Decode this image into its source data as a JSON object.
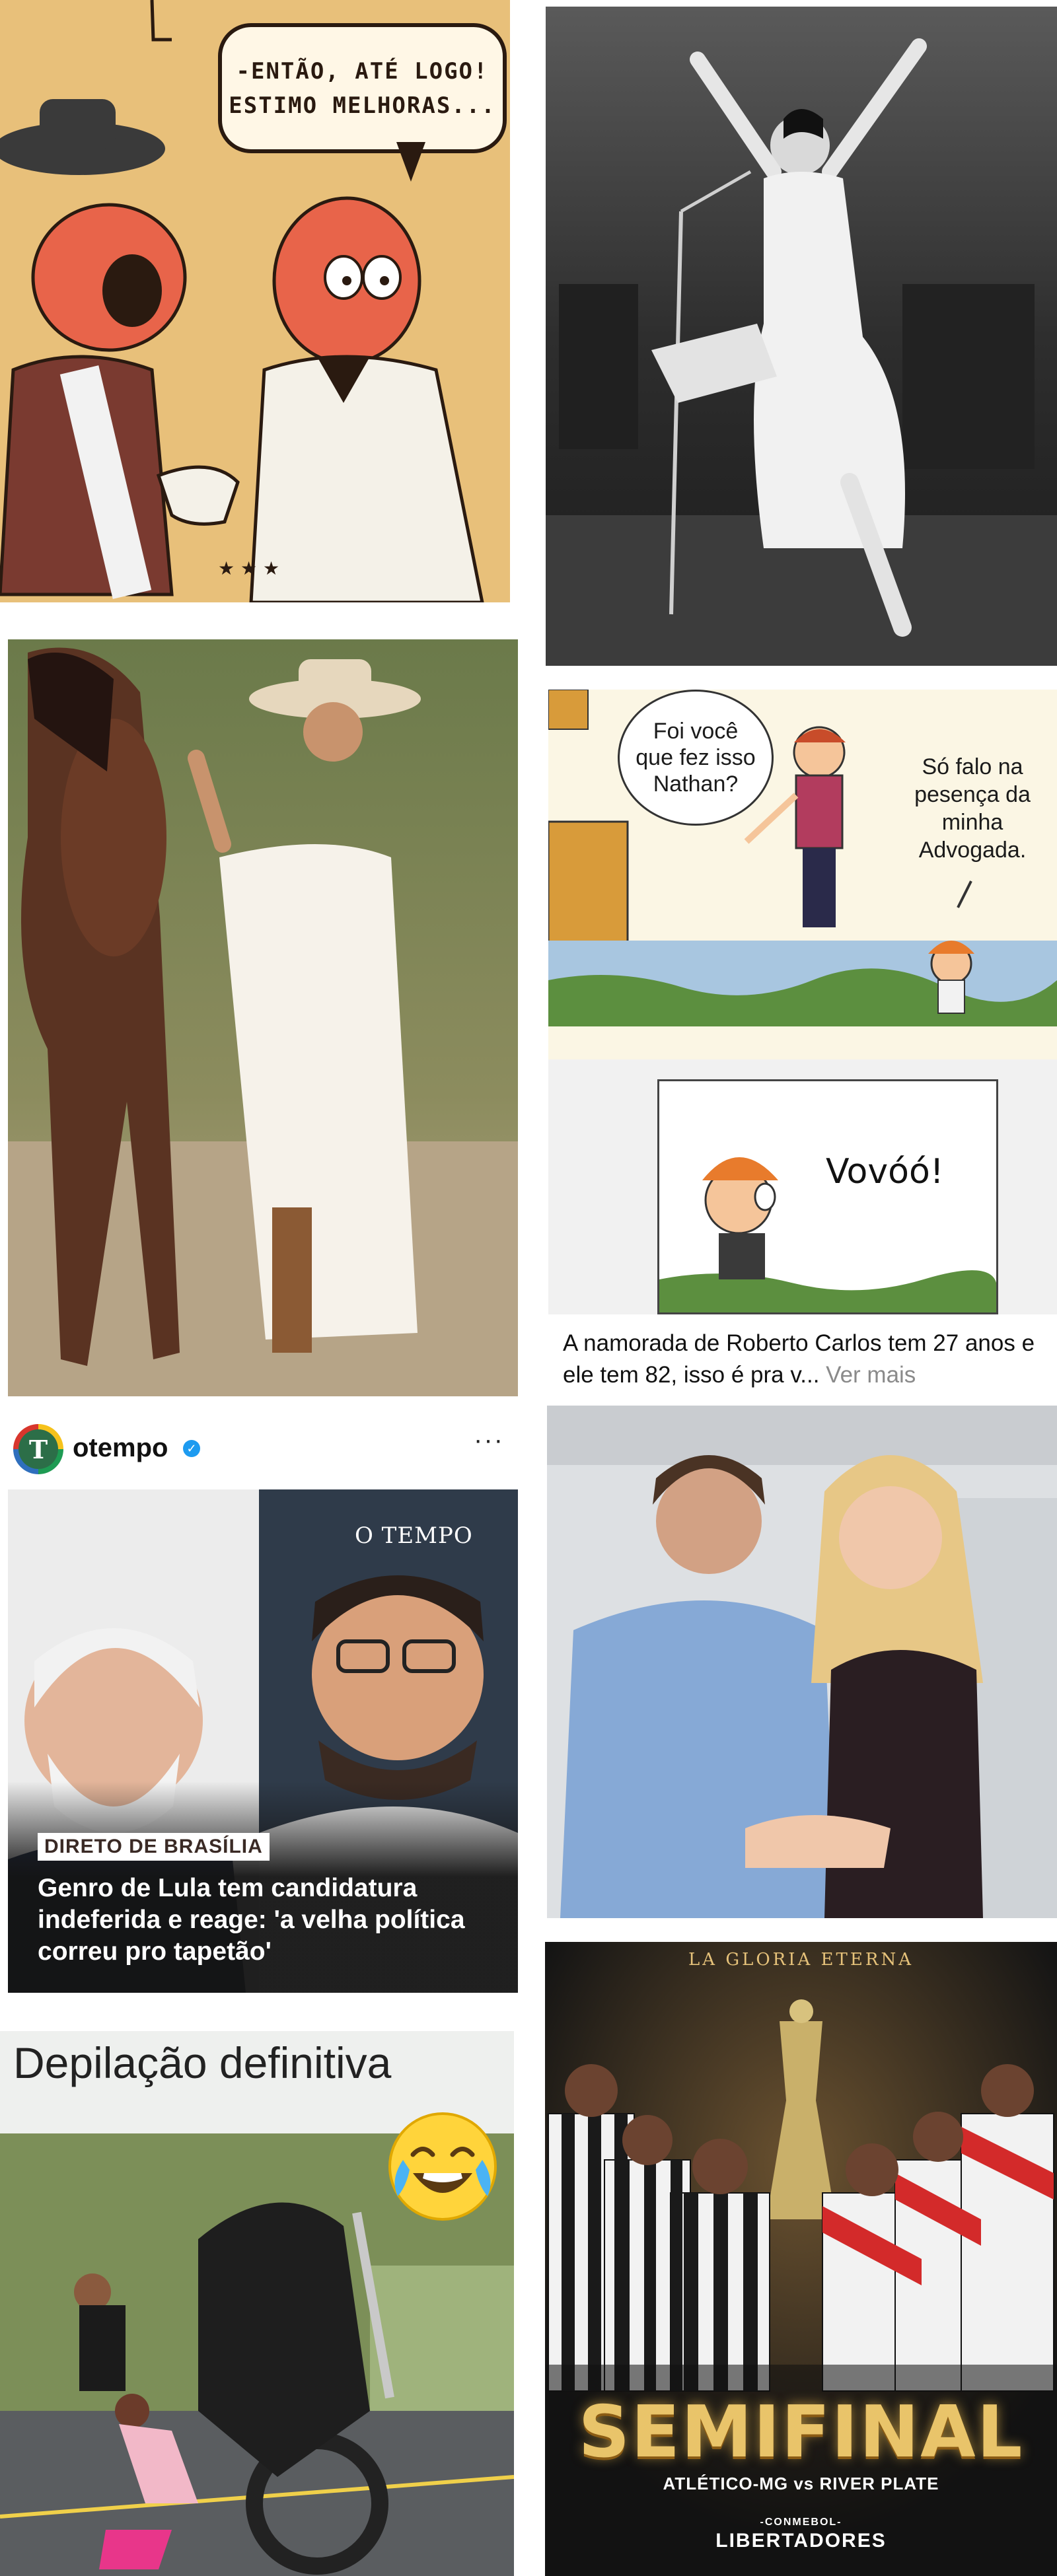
{
  "tiles": {
    "cartoon": {
      "speech_line1": "-ENTÃO, ATÉ LOGO!",
      "speech_line2": "ESTIMO MELHORAS..."
    },
    "comic": {
      "bubble_left_line1": "Foi você",
      "bubble_left_line2": "que fez isso",
      "bubble_left_line3": "Nathan?",
      "bubble_right_line1": "Só falo na",
      "bubble_right_line2": "pesença da",
      "bubble_right_line3": "minha",
      "bubble_right_line4": "Advogada.",
      "panel2_text": "Vovóó!",
      "caption": "A namorada de Roberto Carlos tem 27 anos e ele tem 82, isso é pra v...",
      "caption_more": "Ver mais"
    },
    "otempo_post": {
      "handle": "otempo",
      "logo_letter": "T",
      "more_icon": "···",
      "brand_watermark": "O TEMPO",
      "tag": "DIRETO DE BRASÍLIA",
      "headline": "Genro de Lula tem candidatura indeferida e reage: 'a velha política correu pro tapetão'"
    },
    "meme": {
      "title": "Depilação definitiva"
    },
    "libertadores": {
      "top_text": "LA GLORIA ETERNA",
      "title": "SEMIFINAL",
      "match": "ATLÉTICO-MG vs RIVER PLATE",
      "conmebol": "-CONMEBOL-",
      "competition": "LIBERTADORES"
    }
  },
  "colors": {
    "verified_blue": "#1d9bf0",
    "gold": "#e9c46a"
  }
}
